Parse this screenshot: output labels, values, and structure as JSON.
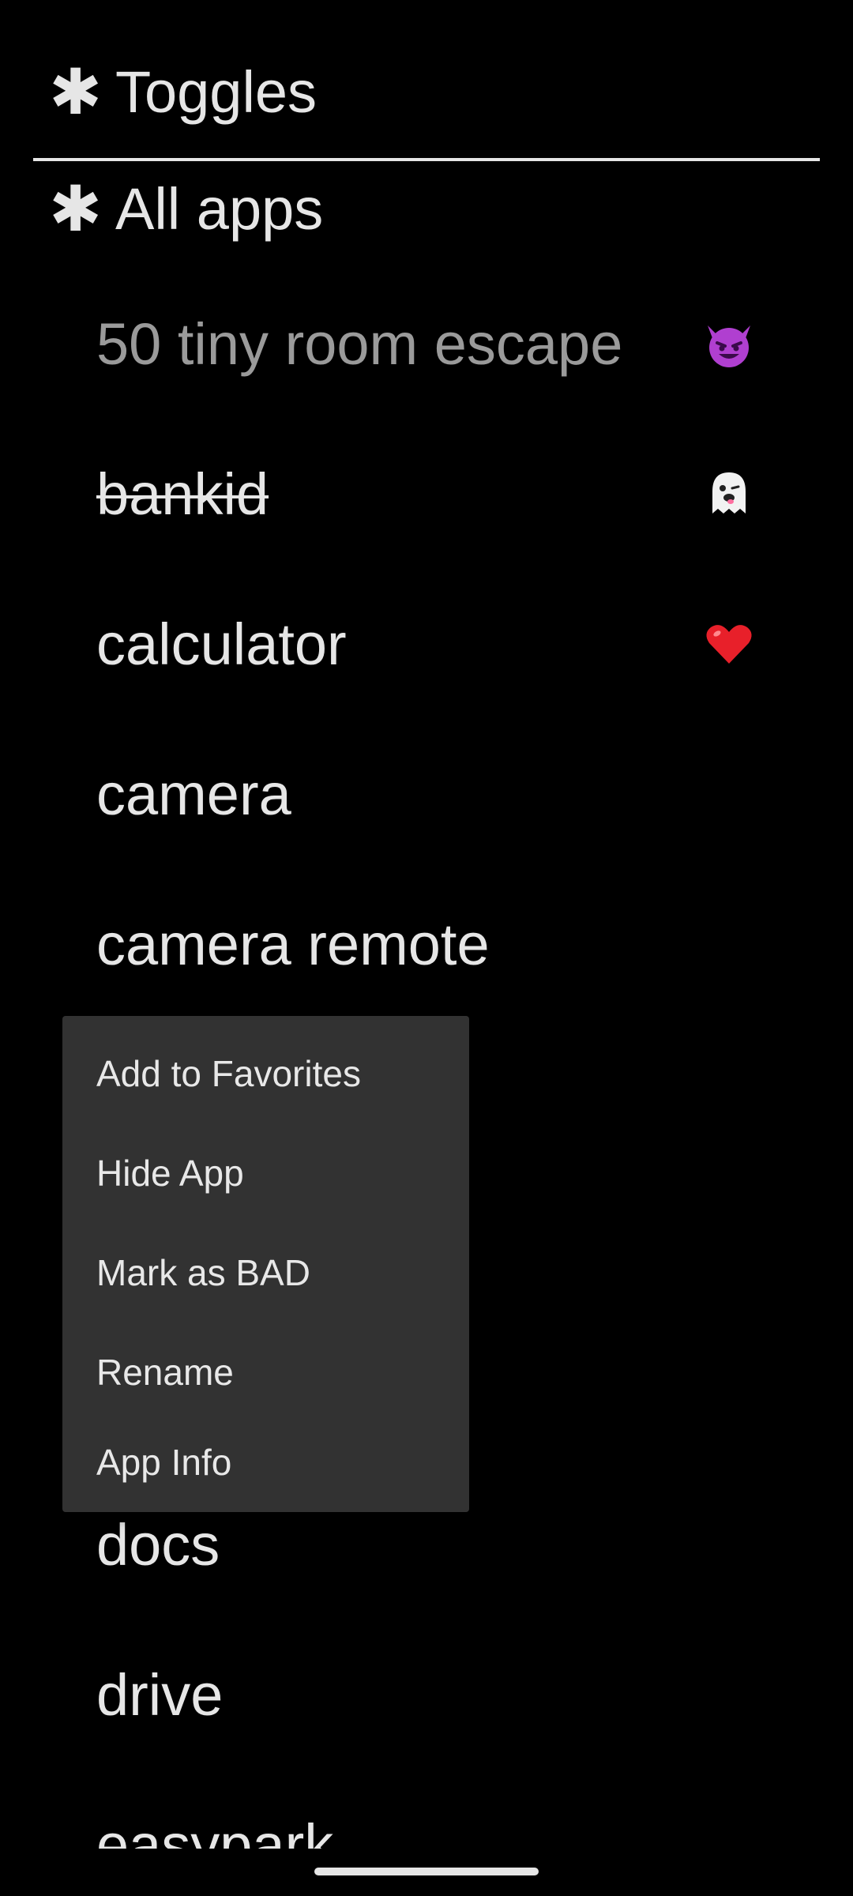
{
  "sections": {
    "toggles": {
      "label": "Toggles",
      "icon": "asterisk-icon"
    },
    "all_apps": {
      "label": "All apps",
      "icon": "asterisk-icon"
    }
  },
  "apps": [
    {
      "label": "50 tiny room escape",
      "style": "dim",
      "emoji": "smiling-devil-icon"
    },
    {
      "label": "bankid",
      "style": "strikethrough",
      "emoji": "ghost-icon"
    },
    {
      "label": "calculator",
      "style": "normal",
      "emoji": "red-heart-icon"
    },
    {
      "label": "camera",
      "style": "normal",
      "emoji": ""
    },
    {
      "label": "camera remote",
      "style": "normal",
      "emoji": ""
    },
    {
      "label": "docs",
      "style": "normal",
      "emoji": ""
    },
    {
      "label": "drive",
      "style": "normal",
      "emoji": ""
    },
    {
      "label": "easypark",
      "style": "normal",
      "emoji": ""
    }
  ],
  "context_menu": {
    "items": [
      "Add to Favorites",
      "Hide App",
      "Mark as BAD",
      "Rename",
      "App Info"
    ]
  },
  "colors": {
    "background": "#000000",
    "text": "#e6e6e6",
    "dim_text": "#9a9a9a",
    "menu_bg": "#323232",
    "devil": "#b03fd0",
    "heart": "#e8202a"
  }
}
